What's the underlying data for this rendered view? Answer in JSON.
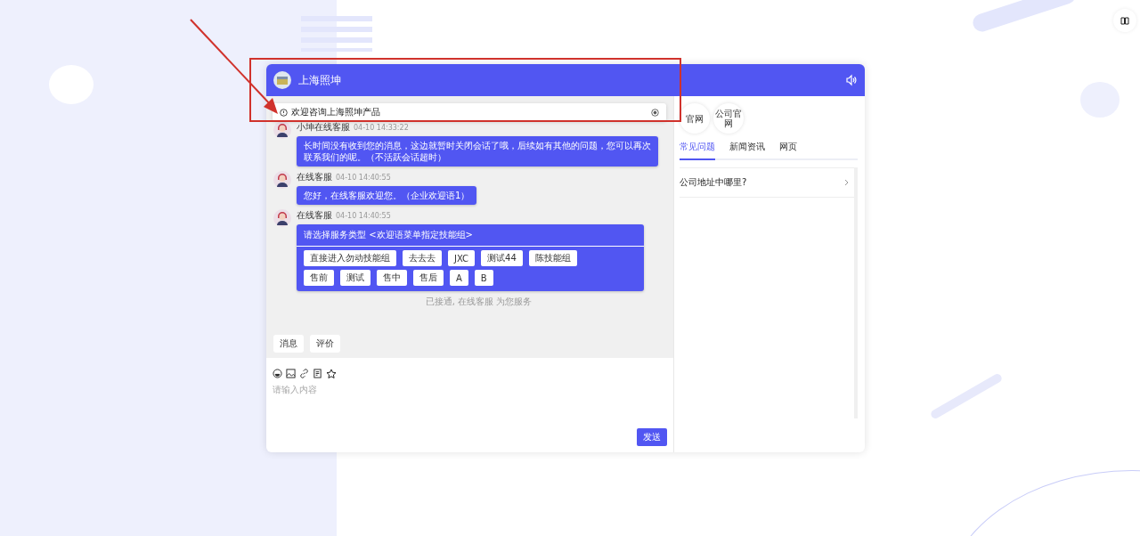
{
  "header": {
    "title": "上海照坤"
  },
  "notice": {
    "text": "欢迎咨询上海照坤产品"
  },
  "messages": [
    {
      "kind": "text",
      "sender": "小坤在线客服",
      "time": "04-10 14:33:22",
      "text": "长时间没有收到您的消息，这边就暂时关闭会话了哦，后续如有其他的问题，您可以再次联系我们的呢。（不活跃会话超时）"
    },
    {
      "kind": "text",
      "sender": "在线客服",
      "time": "04-10 14:40:55",
      "text": "您好，在线客服欢迎您。（企业欢迎语1）"
    },
    {
      "kind": "menu",
      "sender": "在线客服",
      "time": "04-10 14:40:55",
      "text": "请选择服务类型 <欢迎语菜单指定技能组>",
      "options": [
        [
          "直接进入勿动技能组",
          "去去去",
          "JXC",
          "测试44",
          "陈技能组"
        ],
        [
          "售前",
          "测试",
          "售中",
          "售后",
          "A",
          "B"
        ]
      ]
    }
  ],
  "system_note": "已接通, 在线客服 为您服务",
  "quick_buttons": [
    "消息",
    "评价"
  ],
  "composer": {
    "placeholder": "请输入内容",
    "send": "发送"
  },
  "links": [
    "官网",
    "公司官网"
  ],
  "tabs": [
    {
      "label": "常见问题",
      "selected": true
    },
    {
      "label": "新闻资讯",
      "selected": false
    },
    {
      "label": "网页",
      "selected": false
    }
  ],
  "faq": [
    "公司地址中哪里?"
  ]
}
